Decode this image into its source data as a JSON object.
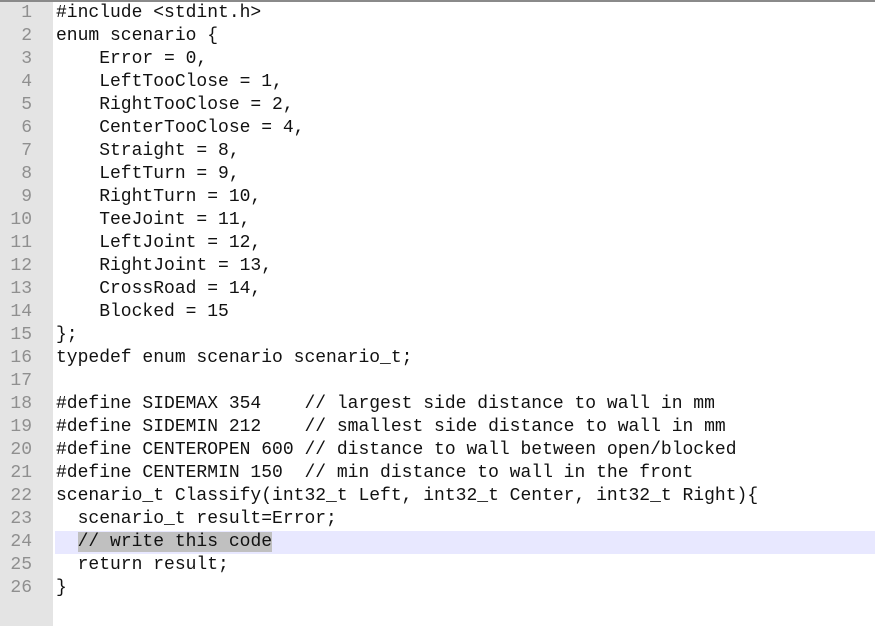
{
  "editor": {
    "current_line": 24,
    "selected_text": "// write this code",
    "lines": [
      {
        "n": "1",
        "text": "#include <stdint.h>"
      },
      {
        "n": "2",
        "text": "enum scenario {"
      },
      {
        "n": "3",
        "text": "    Error = 0,"
      },
      {
        "n": "4",
        "text": "    LeftTooClose = 1,"
      },
      {
        "n": "5",
        "text": "    RightTooClose = 2,"
      },
      {
        "n": "6",
        "text": "    CenterTooClose = 4,"
      },
      {
        "n": "7",
        "text": "    Straight = 8,"
      },
      {
        "n": "8",
        "text": "    LeftTurn = 9,"
      },
      {
        "n": "9",
        "text": "    RightTurn = 10,"
      },
      {
        "n": "10",
        "text": "    TeeJoint = 11,"
      },
      {
        "n": "11",
        "text": "    LeftJoint = 12,"
      },
      {
        "n": "12",
        "text": "    RightJoint = 13,"
      },
      {
        "n": "13",
        "text": "    CrossRoad = 14,"
      },
      {
        "n": "14",
        "text": "    Blocked = 15"
      },
      {
        "n": "15",
        "text": "};"
      },
      {
        "n": "16",
        "text": "typedef enum scenario scenario_t;"
      },
      {
        "n": "17",
        "text": ""
      },
      {
        "n": "18",
        "text": "#define SIDEMAX 354    // largest side distance to wall in mm"
      },
      {
        "n": "19",
        "text": "#define SIDEMIN 212    // smallest side distance to wall in mm"
      },
      {
        "n": "20",
        "text": "#define CENTEROPEN 600 // distance to wall between open/blocked"
      },
      {
        "n": "21",
        "text": "#define CENTERMIN 150  // min distance to wall in the front"
      },
      {
        "n": "22",
        "text": "scenario_t Classify(int32_t Left, int32_t Center, int32_t Right){"
      },
      {
        "n": "23",
        "text": "  scenario_t result=Error;"
      },
      {
        "n": "24",
        "text": "  // write this code"
      },
      {
        "n": "25",
        "text": "  return result;"
      },
      {
        "n": "26",
        "text": "}"
      }
    ]
  }
}
